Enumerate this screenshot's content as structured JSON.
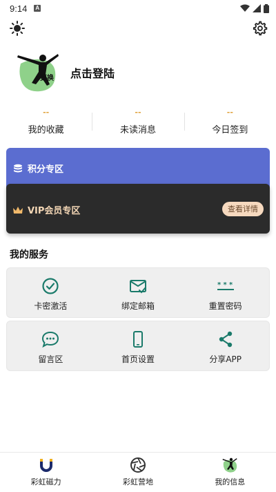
{
  "status_bar": {
    "time": "9:14",
    "notification_icon": "A"
  },
  "profile": {
    "login_label": "点击登陆",
    "avatar_badge": "更换"
  },
  "stats": [
    {
      "value": "--",
      "label": "我的收藏"
    },
    {
      "value": "--",
      "label": "未读消息"
    },
    {
      "value": "--",
      "label": "今日签到"
    }
  ],
  "points": {
    "label": "积分专区"
  },
  "vip": {
    "label": "VIP会员专区",
    "button": "查看详情"
  },
  "services": {
    "title": "我的服务",
    "items": [
      {
        "label": "卡密激活",
        "icon": "check-circle-icon"
      },
      {
        "label": "绑定邮箱",
        "icon": "mail-check-icon"
      },
      {
        "label": "重置密码",
        "icon": "password-icon"
      },
      {
        "label": "留言区",
        "icon": "chat-icon"
      },
      {
        "label": "首页设置",
        "icon": "phone-icon"
      },
      {
        "label": "分享APP",
        "icon": "share-icon"
      }
    ]
  },
  "tabs": [
    {
      "label": "彩虹磁力",
      "icon": "magnet-icon"
    },
    {
      "label": "彩虹营地",
      "icon": "aperture-icon"
    },
    {
      "label": "我的信息",
      "icon": "avatar-icon"
    }
  ],
  "colors": {
    "accent": "#1a7a6a",
    "points_card": "#5b6dd0",
    "vip_card": "#2b2b2b",
    "stat_value": "#e0a23a"
  }
}
